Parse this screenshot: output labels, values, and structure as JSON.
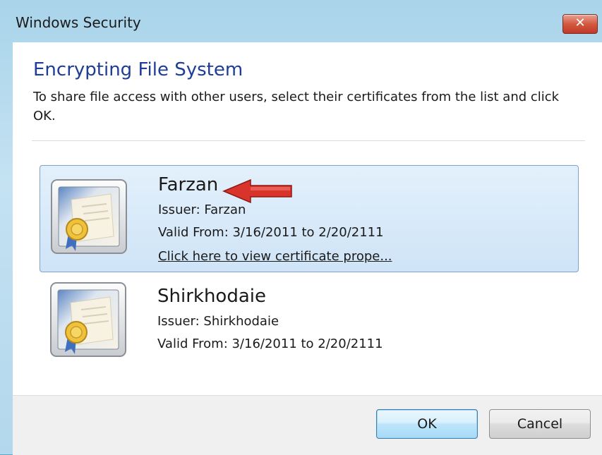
{
  "window": {
    "title": "Windows Security",
    "close_label": "✕"
  },
  "dialog": {
    "heading": "Encrypting File System",
    "instructions": "To share file access with other users, select their certificates from the list and click OK."
  },
  "certificates": [
    {
      "name": "Farzan",
      "issuer": "Issuer: Farzan",
      "valid": "Valid From: 3/16/2011 to 2/20/2111",
      "link": "Click here to view certificate prope...",
      "selected": true
    },
    {
      "name": "Shirkhodaie",
      "issuer": "Issuer: Shirkhodaie",
      "valid": "Valid From: 3/16/2011 to 2/20/2111",
      "selected": false
    }
  ],
  "buttons": {
    "ok": "OK",
    "cancel": "Cancel"
  },
  "colors": {
    "heading": "#1e3d96",
    "selection_bg": "#d8e9f9",
    "selection_border": "#7da2ce",
    "close_red": "#c0392b",
    "arrow_red": "#d9342b"
  },
  "icons": {
    "certificate": "certificate-icon",
    "close": "close-icon",
    "annotation_arrow": "red-arrow-icon"
  }
}
